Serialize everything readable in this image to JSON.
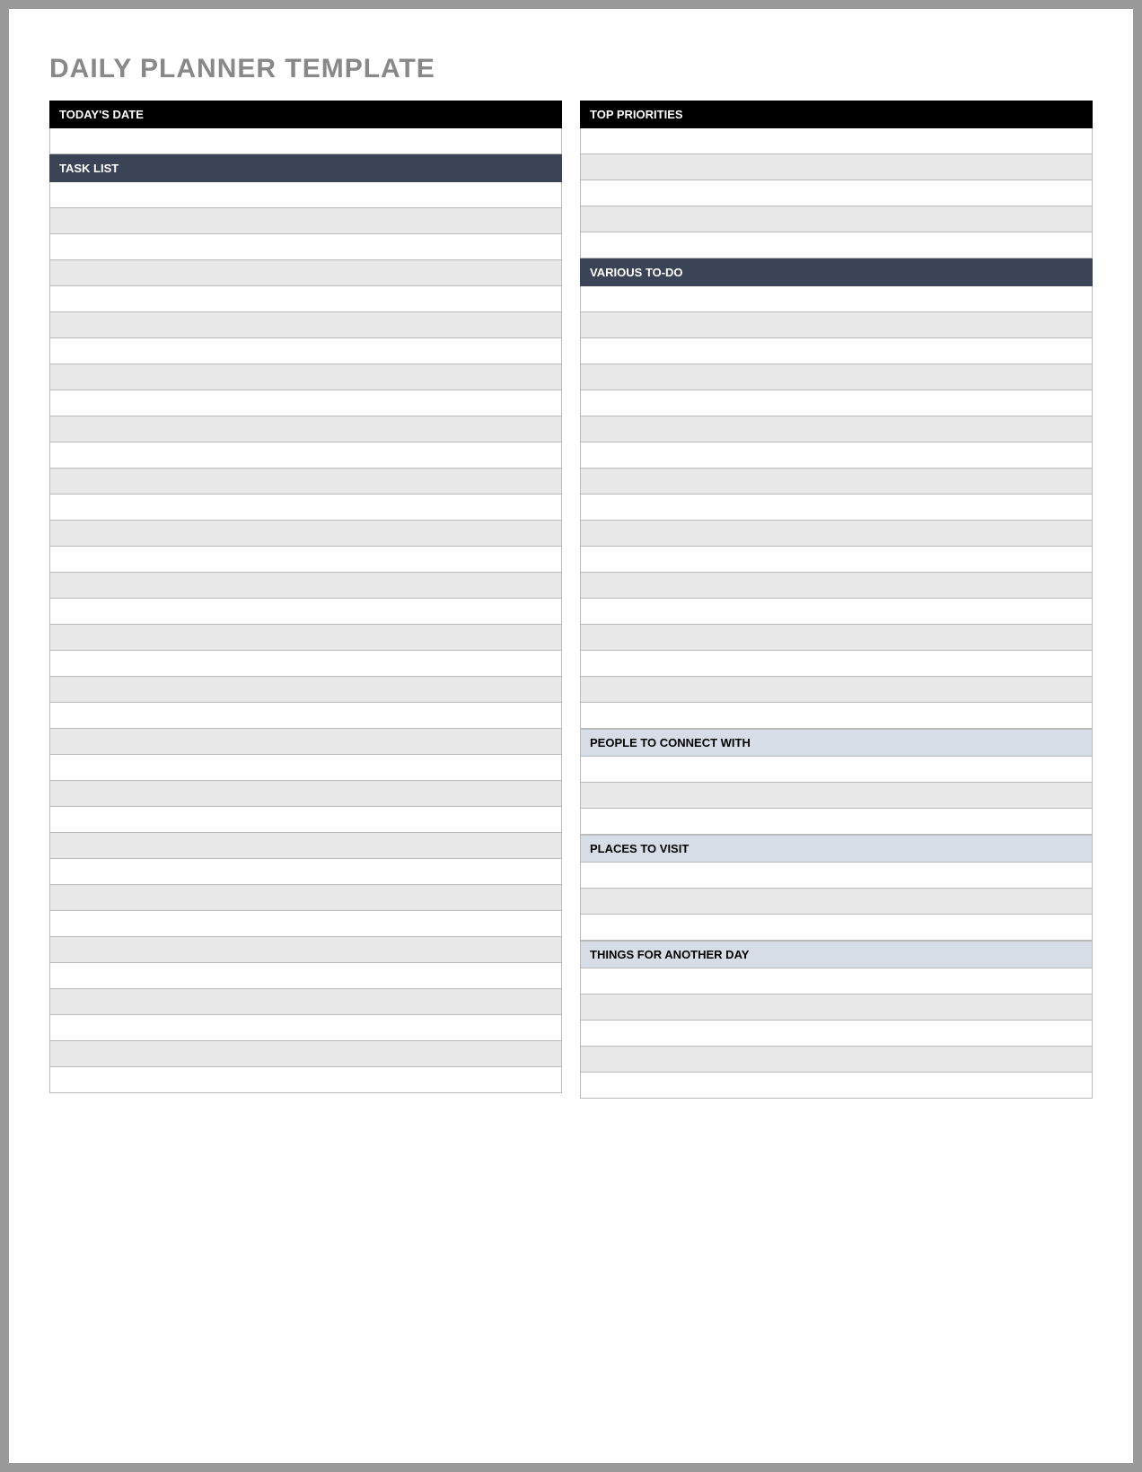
{
  "title": "DAILY PLANNER TEMPLATE",
  "left": {
    "date_header": "TODAY'S DATE",
    "task_header": "TASK LIST"
  },
  "right": {
    "priorities_header": "TOP PRIORITIES",
    "todo_header": "VARIOUS TO-DO",
    "people_header": "PEOPLE TO CONNECT WITH",
    "places_header": "PLACES TO VISIT",
    "things_header": "THINGS FOR ANOTHER DAY"
  },
  "rows": {
    "date": 1,
    "tasks": 35,
    "priorities": 5,
    "todo": 17,
    "people": 3,
    "places": 3,
    "things": 5
  }
}
